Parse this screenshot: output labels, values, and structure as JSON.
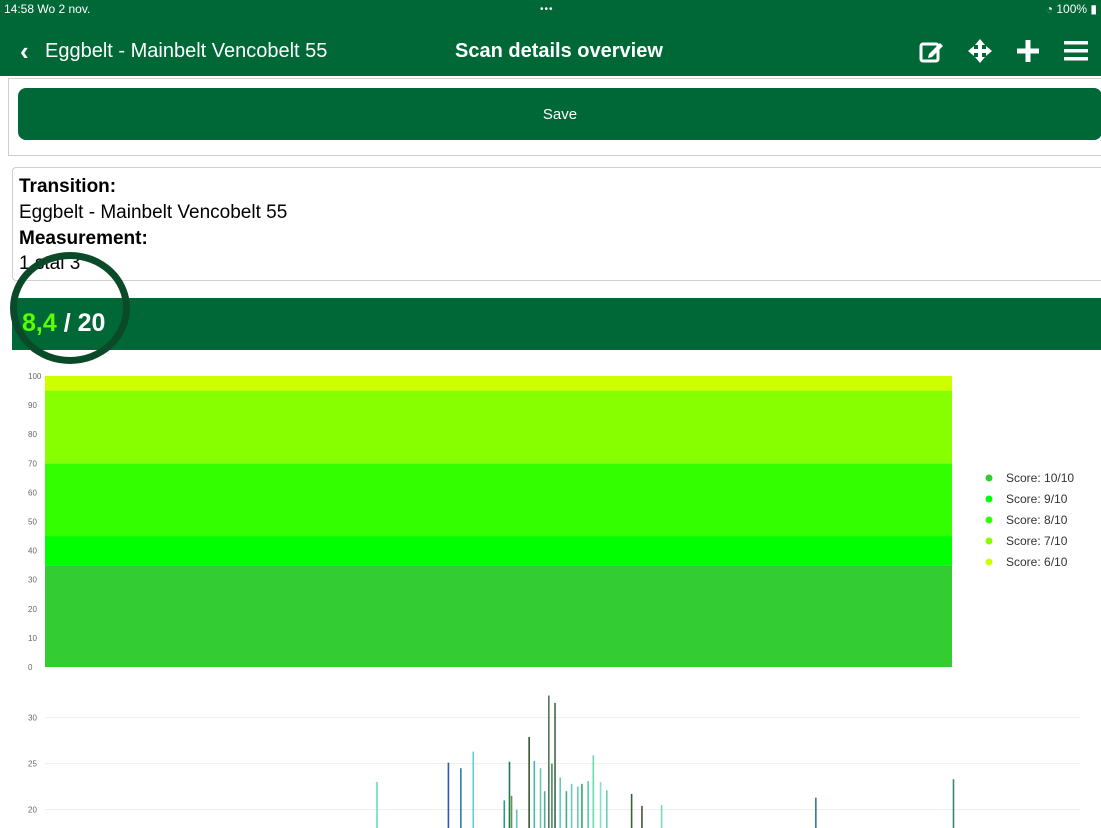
{
  "status": {
    "time_date": "14:58  Wo 2 nov.",
    "dots": "•••",
    "battery": "100%"
  },
  "nav": {
    "back_label": "Eggbelt - Mainbelt Vencobelt 55",
    "title": "Scan details overview",
    "icons": [
      "edit-icon",
      "move-icon",
      "plus-icon",
      "menu-icon"
    ]
  },
  "save_label": "Save",
  "info": {
    "transition_label": "Transition:",
    "transition_value": "Eggbelt - Mainbelt Vencobelt 55",
    "measurement_label": "Measurement:",
    "measurement_value": "1 stal 3"
  },
  "score": {
    "value": "8,4",
    "separator": " / ",
    "max": "20",
    "value_color": "#5aff00"
  },
  "colors": {
    "brand": "#006837",
    "white": "#ffffff"
  },
  "chart_data": [
    {
      "type": "area",
      "ylim": [
        0,
        100
      ],
      "yticks": [
        "0",
        "10",
        "20",
        "30",
        "40",
        "50",
        "60",
        "70",
        "80",
        "90",
        "100"
      ],
      "bands": [
        {
          "name": "Score: 10/10",
          "from": 0,
          "to": 35,
          "color": "#33cc33"
        },
        {
          "name": "Score: 9/10",
          "from": 35,
          "to": 45,
          "color": "#00ff00"
        },
        {
          "name": "Score: 8/10",
          "from": 45,
          "to": 70,
          "color": "#33ff00"
        },
        {
          "name": "Score: 7/10",
          "from": 70,
          "to": 95,
          "color": "#88ff00"
        },
        {
          "name": "Score: 6/10",
          "from": 95,
          "to": 100,
          "color": "#ccff00"
        }
      ],
      "legend_position": "right"
    },
    {
      "type": "bar",
      "yticks": [
        "20",
        "25",
        "30"
      ],
      "ylim": [
        18,
        33
      ],
      "x_range": [
        0,
        100
      ],
      "bars": [
        {
          "x": 32.0,
          "y": 23,
          "color": "#66ddbb"
        },
        {
          "x": 38.9,
          "y": 25.1,
          "color": "#3355aa"
        },
        {
          "x": 40.1,
          "y": 24.5,
          "color": "#3377aa"
        },
        {
          "x": 41.3,
          "y": 26.3,
          "color": "#66ccdd"
        },
        {
          "x": 44.3,
          "y": 21.0,
          "color": "#339988"
        },
        {
          "x": 44.8,
          "y": 25.2,
          "color": "#227755"
        },
        {
          "x": 45.0,
          "y": 21.5,
          "color": "#669944"
        },
        {
          "x": 45.5,
          "y": 20.0,
          "color": "#66bbcc"
        },
        {
          "x": 46.7,
          "y": 27.9,
          "color": "#335533"
        },
        {
          "x": 47.2,
          "y": 25.3,
          "color": "#44bbaa"
        },
        {
          "x": 47.8,
          "y": 24.5,
          "color": "#66ccaa"
        },
        {
          "x": 48.2,
          "y": 22.0,
          "color": "#55aa99"
        },
        {
          "x": 48.6,
          "y": 32.4,
          "color": "#557755"
        },
        {
          "x": 48.9,
          "y": 25.0,
          "color": "#448866"
        },
        {
          "x": 49.2,
          "y": 31.6,
          "color": "#446644"
        },
        {
          "x": 49.7,
          "y": 23.5,
          "color": "#66ccbb"
        },
        {
          "x": 50.3,
          "y": 22.0,
          "color": "#44aa88"
        },
        {
          "x": 50.8,
          "y": 22.8,
          "color": "#66ccbb"
        },
        {
          "x": 51.4,
          "y": 22.5,
          "color": "#66ccbb"
        },
        {
          "x": 51.8,
          "y": 22.8,
          "color": "#33aa66"
        },
        {
          "x": 52.4,
          "y": 23.1,
          "color": "#55ccaa"
        },
        {
          "x": 52.9,
          "y": 25.9,
          "color": "#66ddaa"
        },
        {
          "x": 53.6,
          "y": 23.0,
          "color": "#88ddcc"
        },
        {
          "x": 54.2,
          "y": 22.1,
          "color": "#66ccbb"
        },
        {
          "x": 56.6,
          "y": 21.7,
          "color": "#336633"
        },
        {
          "x": 57.6,
          "y": 20.4,
          "color": "#445533"
        },
        {
          "x": 59.5,
          "y": 20.5,
          "color": "#77ddbb"
        },
        {
          "x": 74.4,
          "y": 21.3,
          "color": "#337788"
        },
        {
          "x": 87.7,
          "y": 23.3,
          "color": "#338877"
        }
      ]
    }
  ]
}
